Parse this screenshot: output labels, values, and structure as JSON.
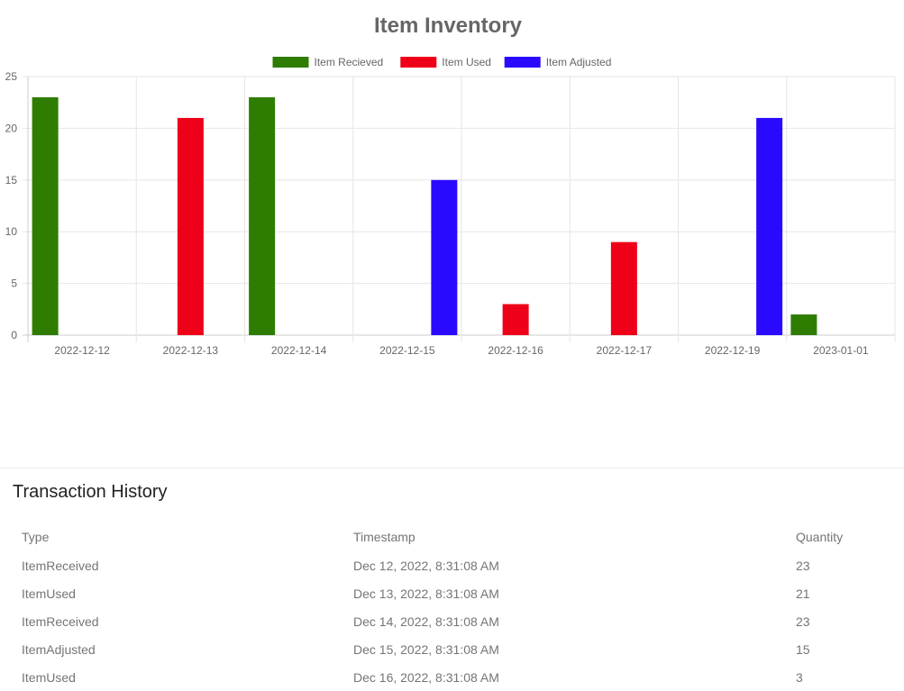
{
  "chart_data": {
    "type": "bar",
    "title": "Item Inventory",
    "categories": [
      "2022-12-12",
      "2022-12-13",
      "2022-12-14",
      "2022-12-15",
      "2022-12-16",
      "2022-12-17",
      "2022-12-19",
      "2023-01-01"
    ],
    "series": [
      {
        "name": "Item Recieved",
        "color": "#2e7d00",
        "values": [
          23,
          0,
          23,
          0,
          0,
          0,
          0,
          2
        ]
      },
      {
        "name": "Item Used",
        "color": "#ef0019",
        "values": [
          0,
          21,
          0,
          0,
          3,
          9,
          0,
          0
        ]
      },
      {
        "name": "Item Adjusted",
        "color": "#2a09ff",
        "values": [
          0,
          0,
          0,
          15,
          0,
          0,
          21,
          0
        ]
      }
    ],
    "ylim": [
      0,
      25
    ],
    "yticks": [
      0,
      5,
      10,
      15,
      20,
      25
    ],
    "grid": true,
    "legend": "top-center"
  },
  "history": {
    "title": "Transaction History",
    "columns": {
      "type": "Type",
      "timestamp": "Timestamp",
      "quantity": "Quantity"
    },
    "rows": [
      {
        "type": "ItemReceived",
        "timestamp": "Dec 12, 2022, 8:31:08 AM",
        "quantity": "23"
      },
      {
        "type": "ItemUsed",
        "timestamp": "Dec 13, 2022, 8:31:08 AM",
        "quantity": "21"
      },
      {
        "type": "ItemReceived",
        "timestamp": "Dec 14, 2022, 8:31:08 AM",
        "quantity": "23"
      },
      {
        "type": "ItemAdjusted",
        "timestamp": "Dec 15, 2022, 8:31:08 AM",
        "quantity": "15"
      },
      {
        "type": "ItemUsed",
        "timestamp": "Dec 16, 2022, 8:31:08 AM",
        "quantity": "3"
      }
    ]
  }
}
